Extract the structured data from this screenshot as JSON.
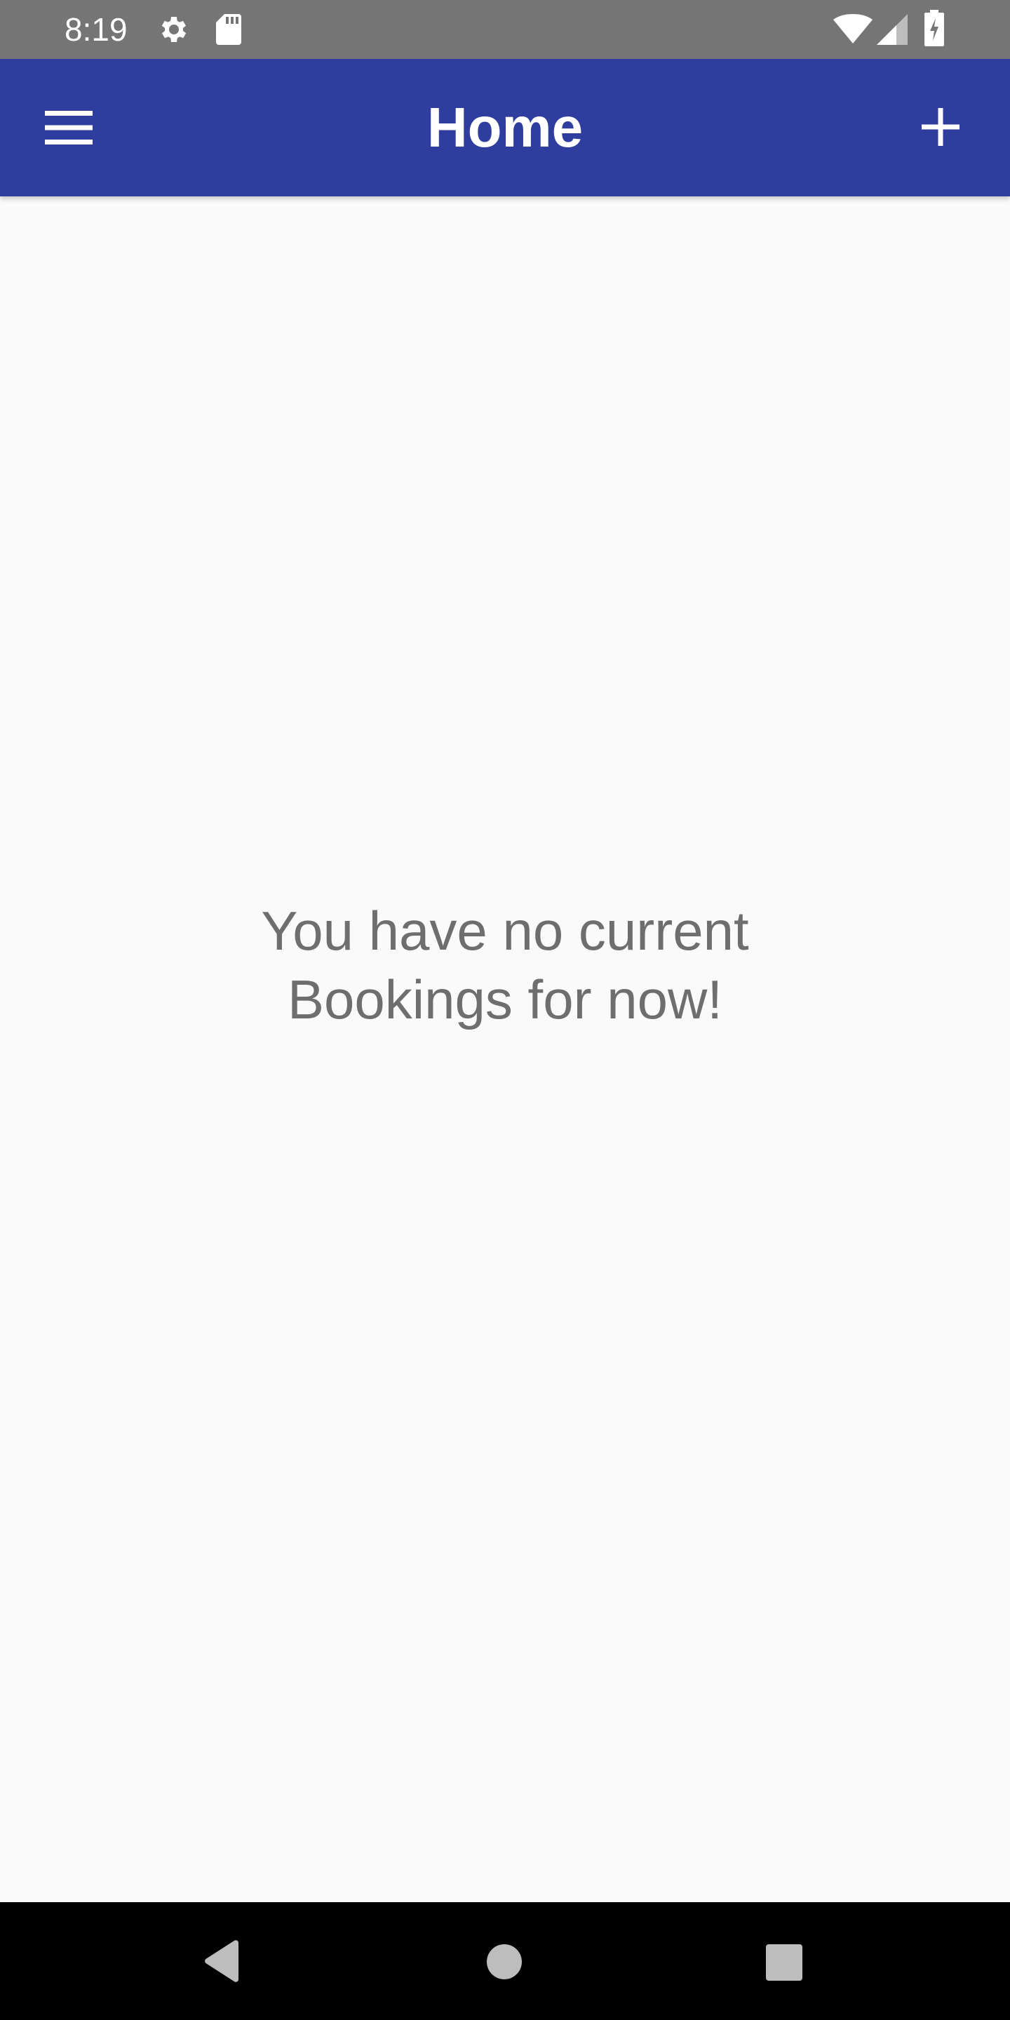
{
  "status_bar": {
    "time": "8:19",
    "icons": [
      "gear-icon",
      "sd-card-icon",
      "wifi-icon",
      "cell-signal-icon",
      "battery-charging-icon"
    ],
    "background": "#757575"
  },
  "app_bar": {
    "title": "Home",
    "left_icon": "hamburger-menu-icon",
    "right_icon": "plus-icon",
    "background": "#2f3e9e"
  },
  "main": {
    "empty_message_line1": "You have no current",
    "empty_message_line2": "Bookings for now!",
    "text_color": "#6e6e6e"
  },
  "nav_bar": {
    "buttons": [
      "back-icon",
      "home-icon",
      "recents-icon"
    ],
    "background": "#000000"
  }
}
